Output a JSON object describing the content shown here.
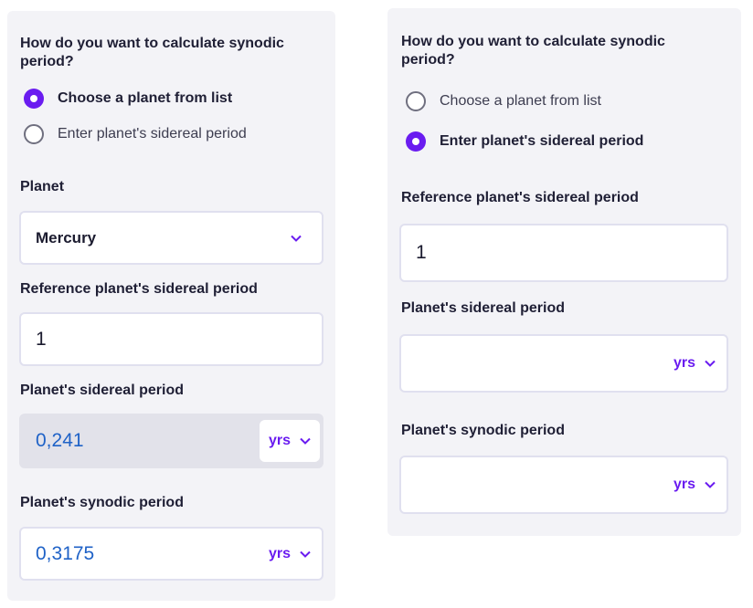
{
  "left": {
    "question": "How do you want to calculate synodic period?",
    "options": [
      {
        "label": "Choose a planet from list",
        "selected": true
      },
      {
        "label": "Enter planet's sidereal period",
        "selected": false
      }
    ],
    "planet": {
      "label": "Planet",
      "value": "Mercury"
    },
    "reference": {
      "label": "Reference planet's sidereal period",
      "value": "1"
    },
    "sidereal": {
      "label": "Planet's sidereal period",
      "value": "0,241",
      "unit": "yrs"
    },
    "synodic": {
      "label": "Planet's synodic period",
      "value": "0,3175",
      "unit": "yrs"
    }
  },
  "right": {
    "question": "How do you want to calculate synodic period?",
    "options": [
      {
        "label": "Choose a planet from list",
        "selected": false
      },
      {
        "label": "Enter planet's sidereal period",
        "selected": true
      }
    ],
    "reference": {
      "label": "Reference planet's sidereal period",
      "value": "1"
    },
    "sidereal": {
      "label": "Planet's sidereal period",
      "value": "",
      "unit": "yrs"
    },
    "synodic": {
      "label": "Planet's synodic period",
      "value": "",
      "unit": "yrs"
    }
  },
  "colors": {
    "accent": "#6a1cf0",
    "result_text": "#1f62c7",
    "panel_bg": "#f3f3f7"
  }
}
